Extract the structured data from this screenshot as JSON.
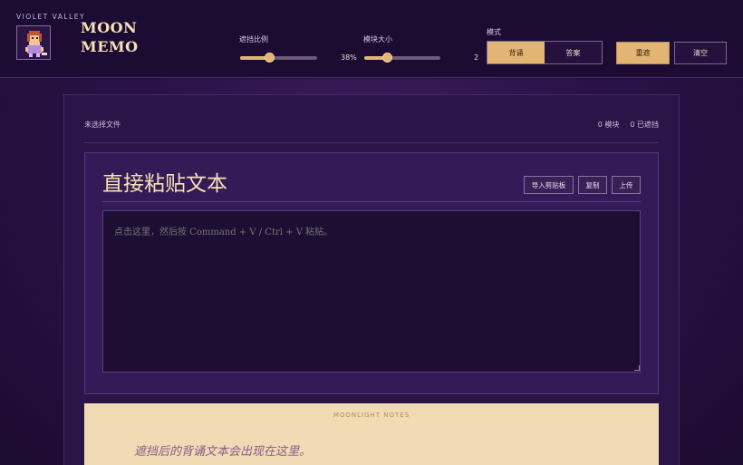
{
  "brand": {
    "kicker": "VIOLET VALLEY",
    "title_line1": "MOON",
    "title_line2": "MEMO"
  },
  "controls": {
    "mask_ratio": {
      "label": "遮挡比例",
      "value_text": "38%",
      "value": 0.38
    },
    "block_size": {
      "label": "模块大小",
      "value_text": "2",
      "value": 0.3
    },
    "mode": {
      "label": "模式",
      "options": [
        "背诵",
        "答案"
      ],
      "selected": "背诵"
    },
    "remask_label": "重遮",
    "clear_label": "清空"
  },
  "status": {
    "file_status": "未选择文件",
    "blocks_count": "0 模块",
    "masked_count": "0 已遮挡"
  },
  "paste": {
    "title": "直接粘贴文本",
    "import_label": "导入剪贴板",
    "copy_label": "复制",
    "upload_label": "上传",
    "placeholder": "点击这里，然后按 Command + V / Ctrl + V 粘贴。"
  },
  "notes": {
    "kicker": "MOONLIGHT NOTES",
    "placeholder_text": "遮挡后的背诵文本会出现在这里。"
  },
  "colors": {
    "accent": "#e3b574",
    "background": "#1f0d3a",
    "panel": "#341a56",
    "notes_bg": "#f0dbb4"
  }
}
